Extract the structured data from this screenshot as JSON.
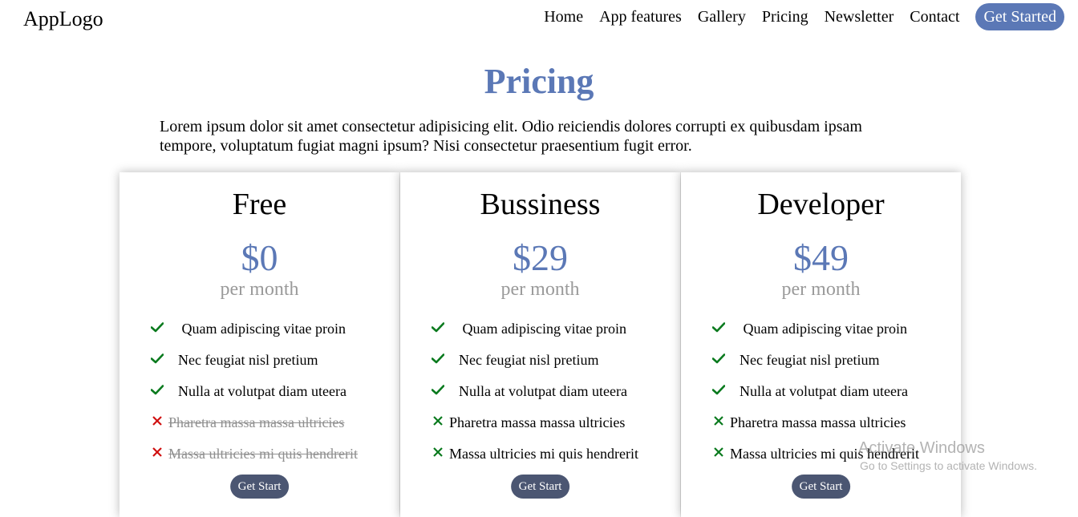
{
  "header": {
    "logo": "AppLogo",
    "nav": [
      "Home",
      "App features",
      "Gallery",
      "Pricing",
      "Newsletter",
      "Contact"
    ],
    "cta": "Get Started"
  },
  "section": {
    "title": "Pricing",
    "intro": "Lorem ipsum dolor sit amet consectetur adipisicing elit. Odio reiciendis dolores corrupti ex quibusdam ipsam tempore, voluptatum fugiat magni ipsum? Nisi consectetur praesentium fugit error."
  },
  "plans": [
    {
      "name": "Free",
      "price": "$0",
      "period": "per month",
      "features": [
        {
          "text": " Quam adipiscing vitae proin",
          "included": true
        },
        {
          "text": "Nec feugiat nisl pretium",
          "included": true
        },
        {
          "text": "Nulla at volutpat diam uteera",
          "included": true
        },
        {
          "text": "Pharetra massa massa ultricies",
          "included": false
        },
        {
          "text": "Massa ultricies mi quis hendrerit",
          "included": false
        }
      ],
      "button": "Get Start"
    },
    {
      "name": "Bussiness",
      "price": "$29",
      "period": "per month",
      "features": [
        {
          "text": " Quam adipiscing vitae proin",
          "included": true
        },
        {
          "text": "Nec feugiat nisl pretium",
          "included": true
        },
        {
          "text": "Nulla at volutpat diam uteera",
          "included": true
        },
        {
          "text": "Pharetra massa massa ultricies",
          "included": true,
          "icon": "cross"
        },
        {
          "text": "Massa ultricies mi quis hendrerit",
          "included": true,
          "icon": "cross"
        }
      ],
      "button": "Get Start"
    },
    {
      "name": "Developer",
      "price": "$49",
      "period": "per month",
      "features": [
        {
          "text": " Quam adipiscing vitae proin",
          "included": true
        },
        {
          "text": "Nec feugiat nisl pretium",
          "included": true
        },
        {
          "text": "Nulla at volutpat diam uteera",
          "included": true
        },
        {
          "text": "Pharetra massa massa ultricies",
          "included": true,
          "icon": "cross"
        },
        {
          "text": "Massa ultricies mi quis hendrerit",
          "included": true,
          "icon": "cross"
        }
      ],
      "button": "Get Start"
    }
  ],
  "watermark": {
    "line1": "Activate Windows",
    "line2": "Go to Settings to activate Windows."
  },
  "colors": {
    "accent": "#5b78b6",
    "button": "#4b5672",
    "check": "#0a7a1e",
    "cross_red": "#d01010",
    "cross_green": "#0a7a1e",
    "muted": "#9a9a9a"
  }
}
